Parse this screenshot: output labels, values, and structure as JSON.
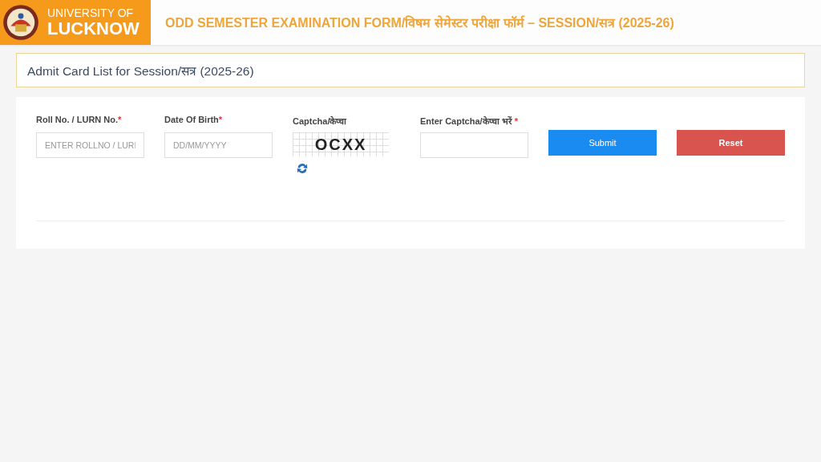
{
  "header": {
    "logo": {
      "line_1": "UNIVERSITY OF",
      "line_2": "LUCKNOW"
    },
    "title": "ODD SEMESTER EXAMINATION FORM/विषम सेमेस्टर परीक्षा फॉर्म – SESSION/सत्र (2025-26)"
  },
  "section": {
    "title": "Admit Card List for Session/सत्र (2025-26)"
  },
  "form": {
    "fields": [
      {
        "kind": "input",
        "label": "Roll No. / LURN No.",
        "required_mark": "*",
        "placeholder": "ENTER ROLLNO / LURI"
      },
      {
        "kind": "input",
        "label": "Date Of Birth",
        "required_mark": "*",
        "placeholder": "DD/MM/YYYY"
      },
      {
        "kind": "captcha",
        "label": "Captcha/केप्चा",
        "captcha_text": "OCXX"
      },
      {
        "kind": "input",
        "label": "Enter Captcha/केप्चा भरें ",
        "required_mark": "*"
      }
    ],
    "buttons": [
      {
        "kind": "primary",
        "label": "Submit"
      },
      {
        "kind": "danger",
        "label": "Reset"
      }
    ]
  }
}
